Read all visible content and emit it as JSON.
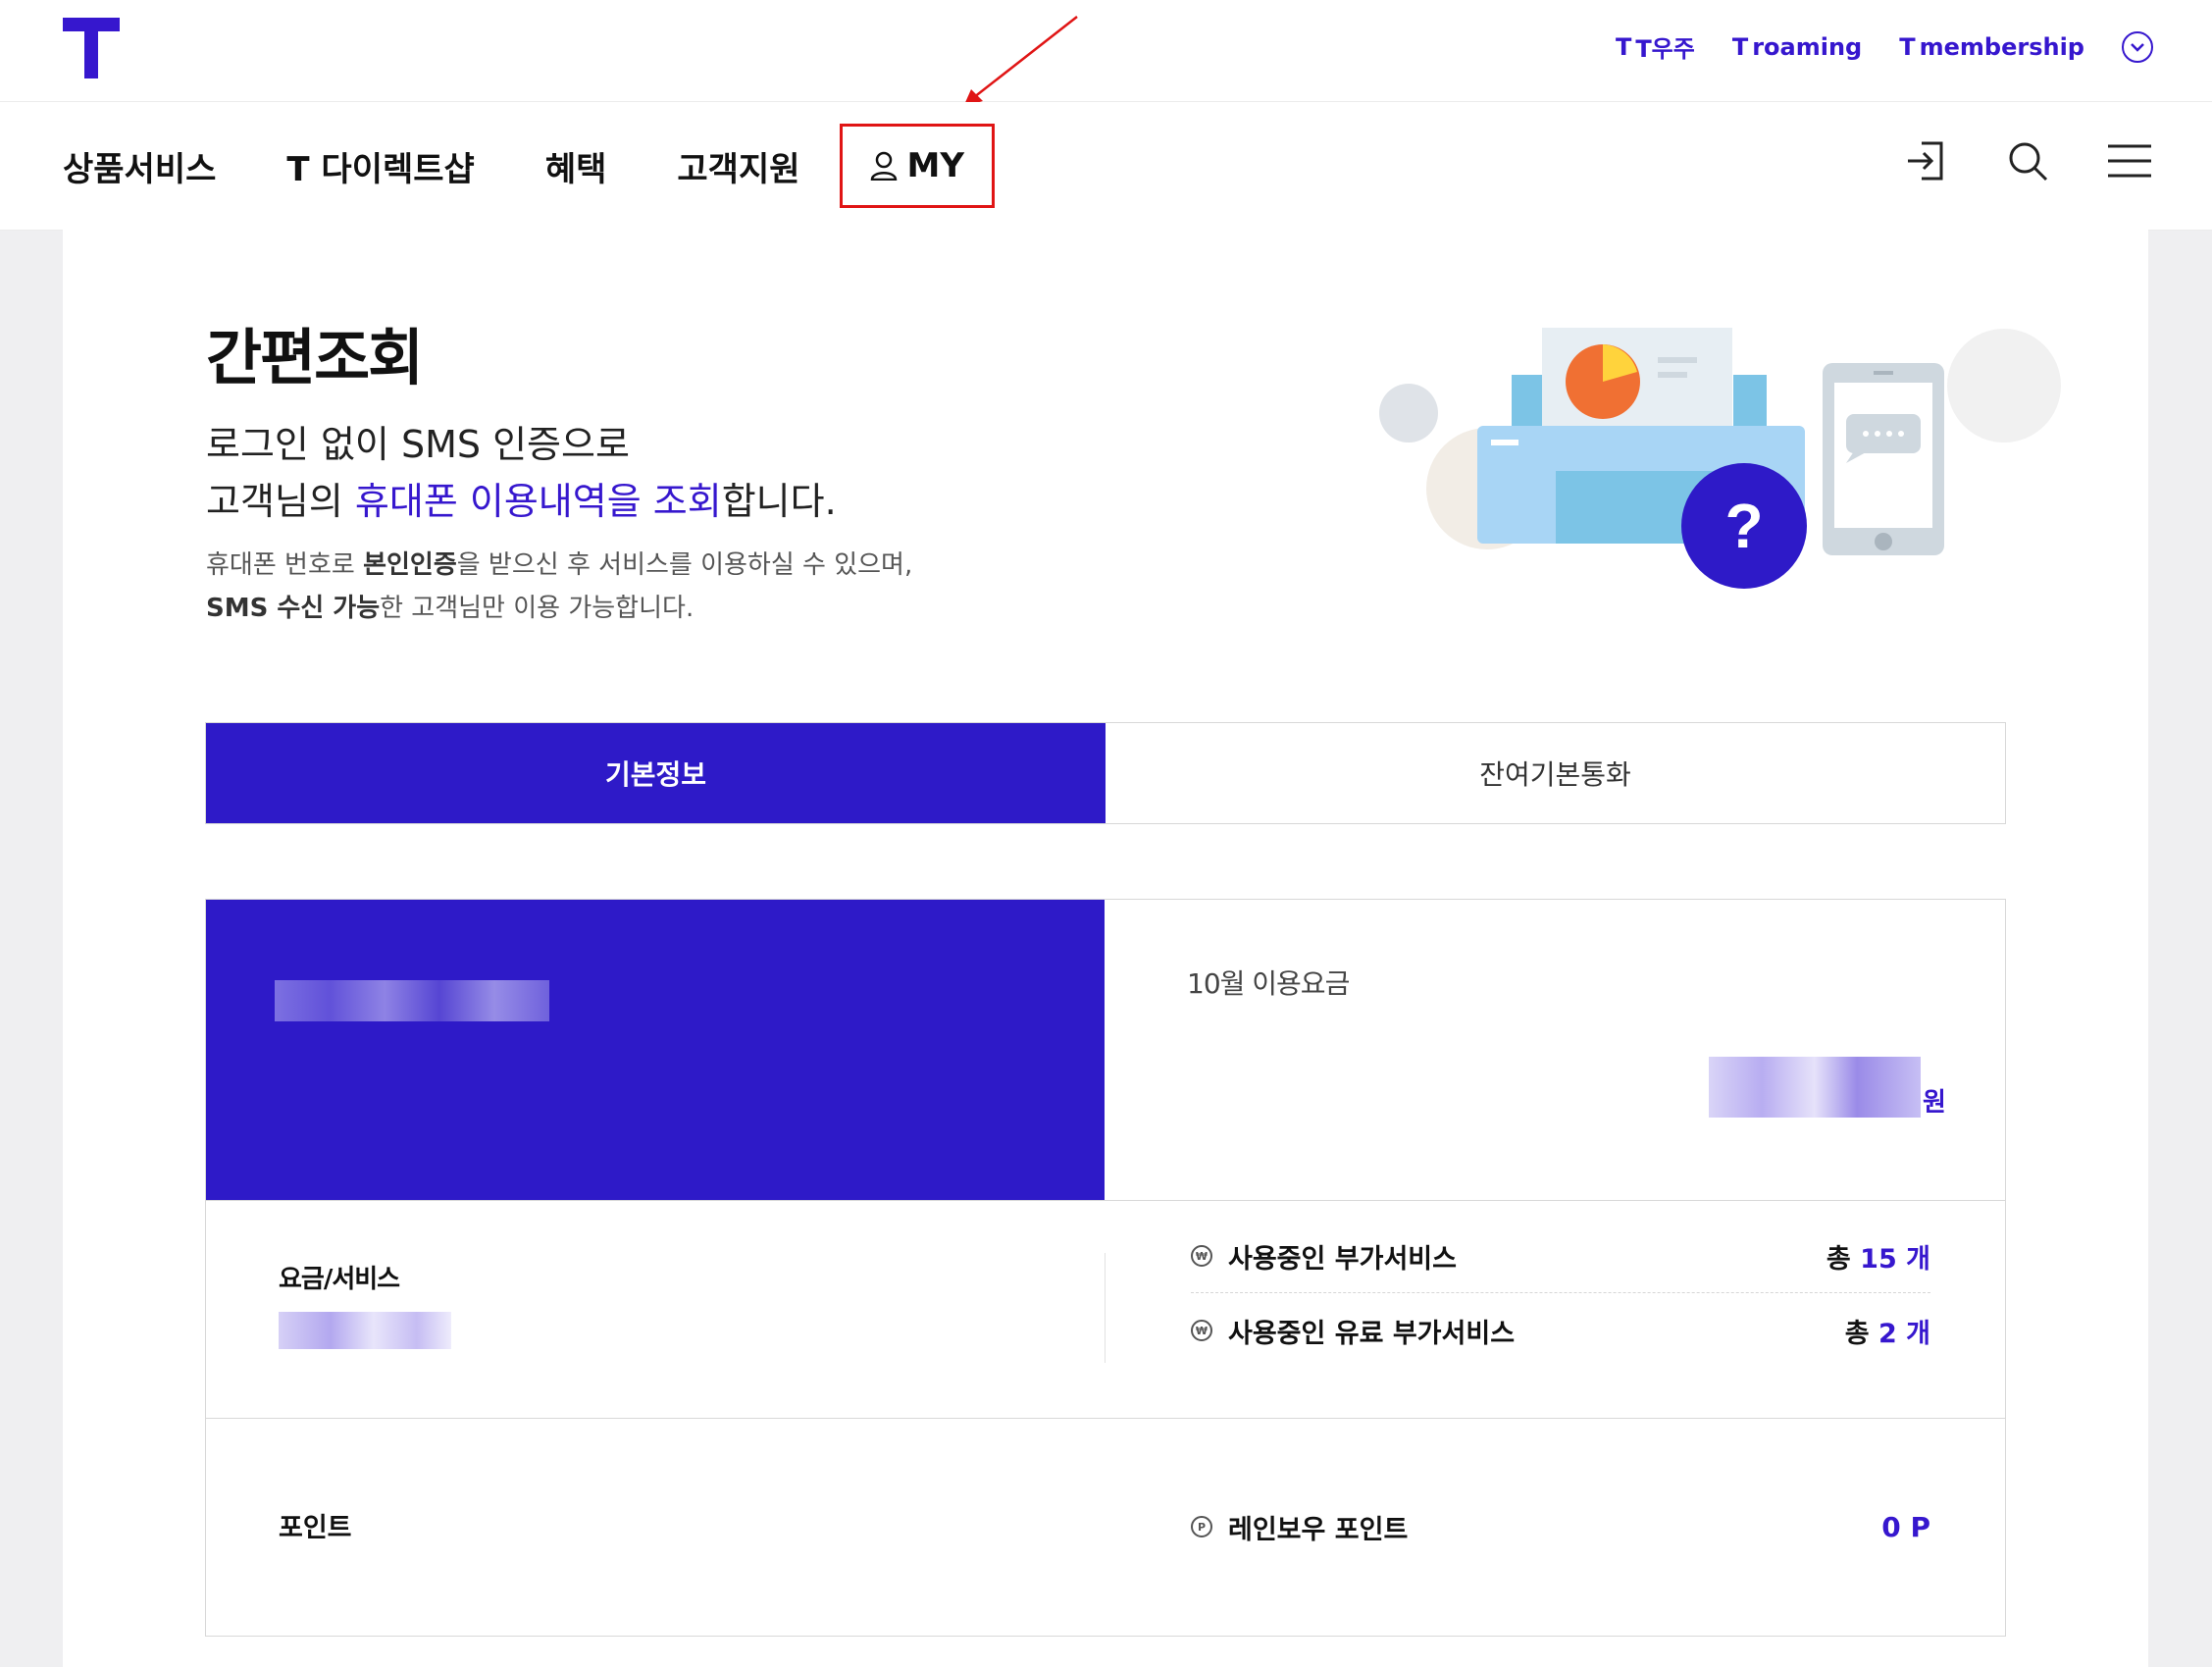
{
  "header": {
    "top_links": [
      "T우주",
      "roaming",
      "membership"
    ],
    "top_link_prefix": "T",
    "nav": [
      "상품서비스",
      "T 다이렉트샵",
      "혜택",
      "고객지원"
    ],
    "my_label": "MY"
  },
  "hero": {
    "title": "간편조회",
    "line1": "로그인 없이 SMS 인증으로",
    "line2_pre": "고객님의 ",
    "line2_highlight": "휴대폰 이용내역을 조회",
    "line2_post": "합니다.",
    "desc1_pre": "휴대폰 번호로 ",
    "desc1_bold": "본인인증",
    "desc1_post": "을 받으신 후 서비스를 이용하실 수 있으며,",
    "desc2_bold": "SMS 수신 가능",
    "desc2_post": "한 고객님만 이용 가능합니다.",
    "illustration_badge": "?"
  },
  "tabs": [
    "기본정보",
    "잔여기본통화"
  ],
  "info": {
    "fee_label": "10월 이용요금",
    "won": "원",
    "service_label": "요금/서비스",
    "addons": [
      {
        "label": "사용중인 부가서비스",
        "prefix": "총 ",
        "count": "15 개"
      },
      {
        "label": "사용중인 유료 부가서비스",
        "prefix": "총 ",
        "count": "2 개"
      }
    ],
    "point_label": "포인트",
    "rainbow_label": "레인보우 포인트",
    "rainbow_value": "0 P"
  },
  "colors": {
    "brand": "#3617ce",
    "highlight_box": "#e01515"
  }
}
